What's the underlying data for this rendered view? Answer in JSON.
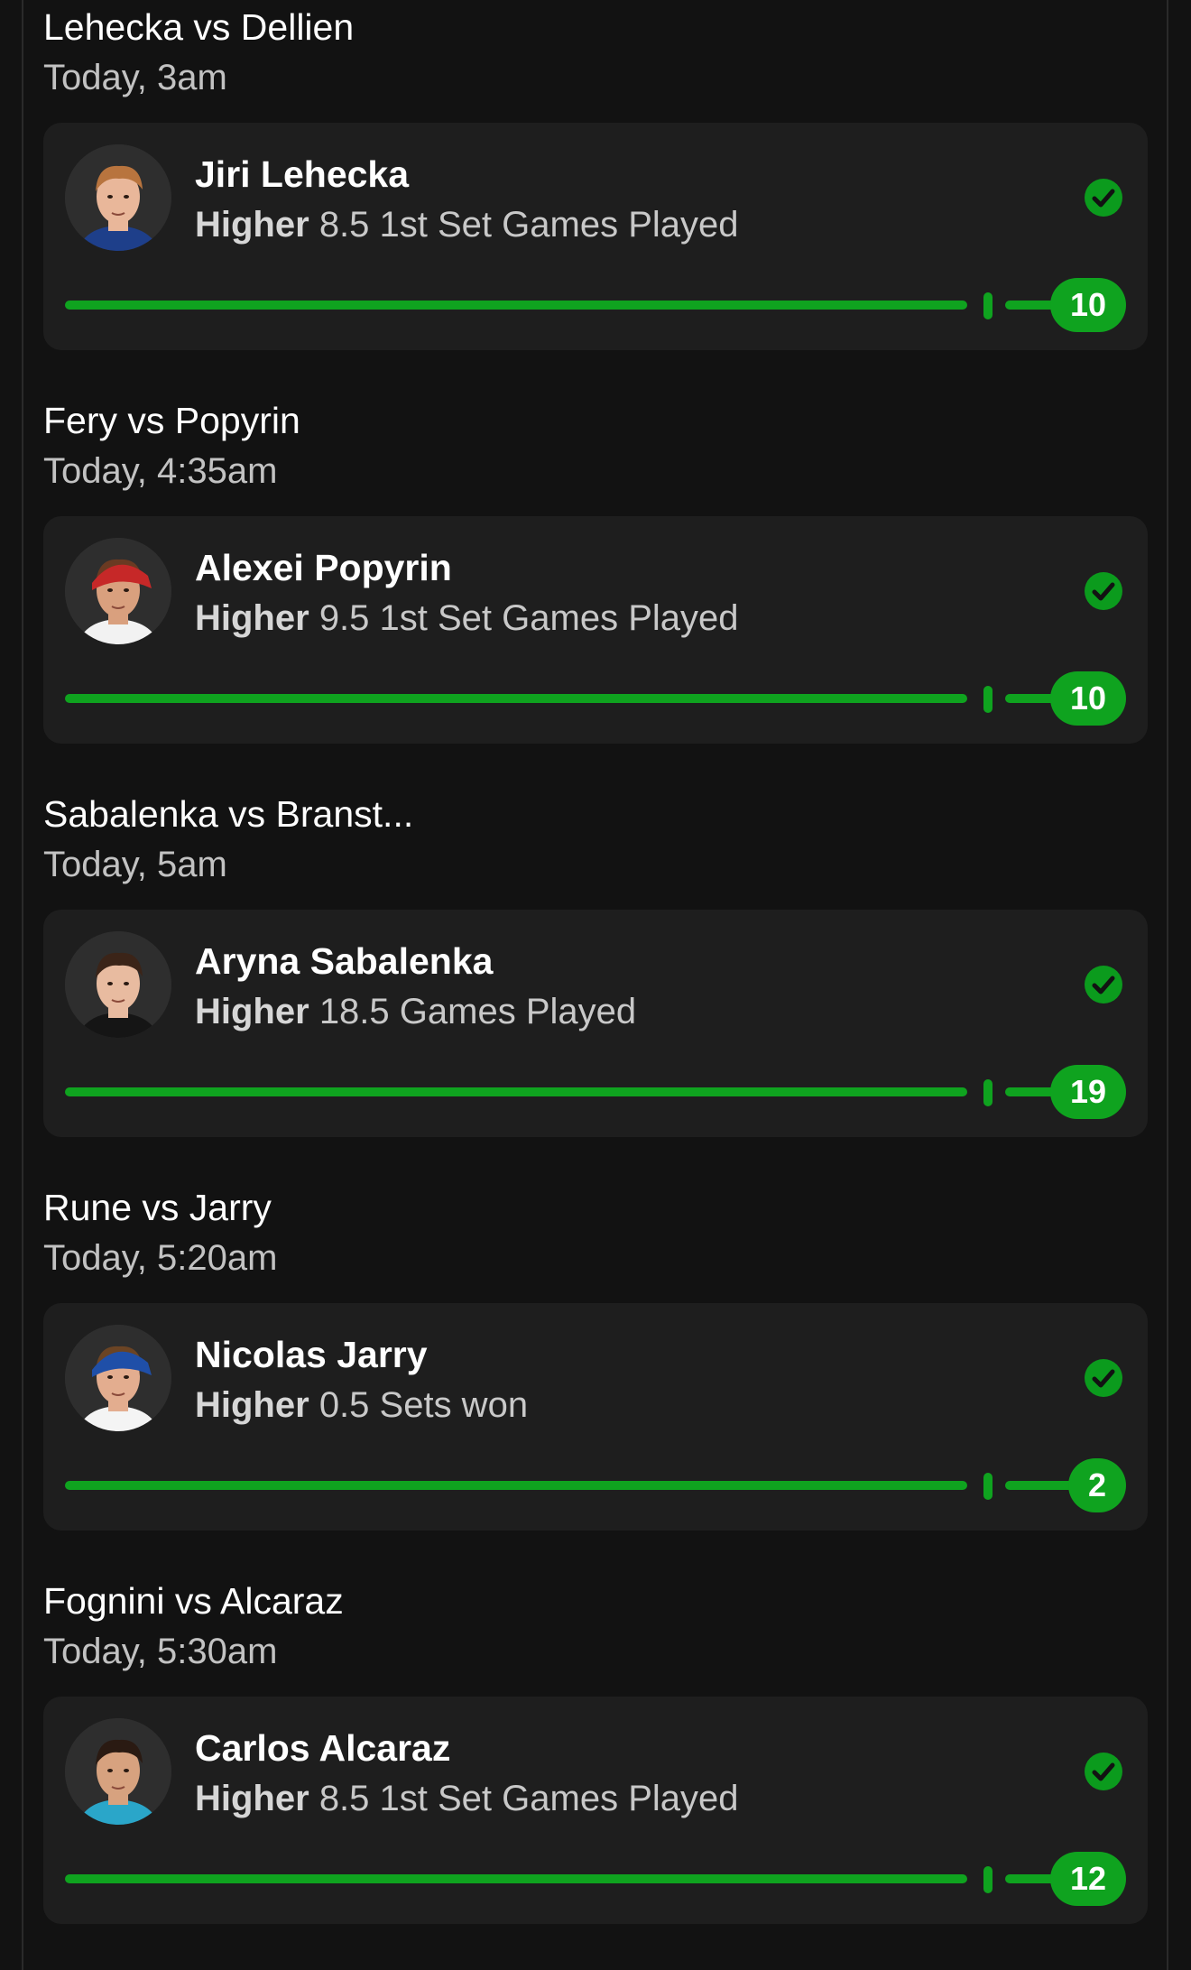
{
  "picks": [
    {
      "match": "Lehecka vs Dellien",
      "time": "Today, 3am",
      "player": "Jiri Lehecka",
      "direction": "Higher",
      "line": "8.5 1st Set Games Played",
      "result": "10",
      "status": "won",
      "avatar_icon": "player-headshot",
      "avatar_colors": {
        "skin": "#e9b79a",
        "hair": "#b8743e",
        "shirt": "#1e3f8a",
        "cap": ""
      }
    },
    {
      "match": "Fery vs Popyrin",
      "time": "Today, 4:35am",
      "player": "Alexei Popyrin",
      "direction": "Higher",
      "line": "9.5 1st Set Games Played",
      "result": "10",
      "status": "won",
      "avatar_icon": "player-headshot",
      "avatar_colors": {
        "skin": "#d9a07e",
        "hair": "#6a3a22",
        "shirt": "#f2f2f2",
        "cap": "#c62828"
      }
    },
    {
      "match": "Sabalenka vs Branst...",
      "time": "Today, 5am",
      "player": "Aryna Sabalenka",
      "direction": "Higher",
      "line": "18.5 Games Played",
      "result": "19",
      "status": "won",
      "avatar_icon": "player-headshot",
      "avatar_colors": {
        "skin": "#e8bba0",
        "hair": "#3b2418",
        "shirt": "#151515",
        "cap": ""
      }
    },
    {
      "match": "Rune vs Jarry",
      "time": "Today, 5:20am",
      "player": "Nicolas Jarry",
      "direction": "Higher",
      "line": "0.5 Sets won",
      "result": "2",
      "status": "won",
      "avatar_icon": "player-headshot",
      "avatar_colors": {
        "skin": "#e3ad8f",
        "hair": "#6b4424",
        "shirt": "#f4f4f4",
        "cap": "#1f4fa8"
      }
    },
    {
      "match": "Fognini vs Alcaraz",
      "time": "Today, 5:30am",
      "player": "Carlos Alcaraz",
      "direction": "Higher",
      "line": "8.5 1st Set Games Played",
      "result": "12",
      "status": "won",
      "avatar_icon": "player-headshot",
      "avatar_colors": {
        "skin": "#d7a27f",
        "hair": "#2a1a12",
        "shirt": "#2aa6c9",
        "cap": ""
      }
    }
  ],
  "colors": {
    "background": "#121212",
    "card": "#1e1e1e",
    "accent_green": "#0fa31f",
    "check_green": "#0b9b1d",
    "muted_text": "#c2c2c2"
  }
}
